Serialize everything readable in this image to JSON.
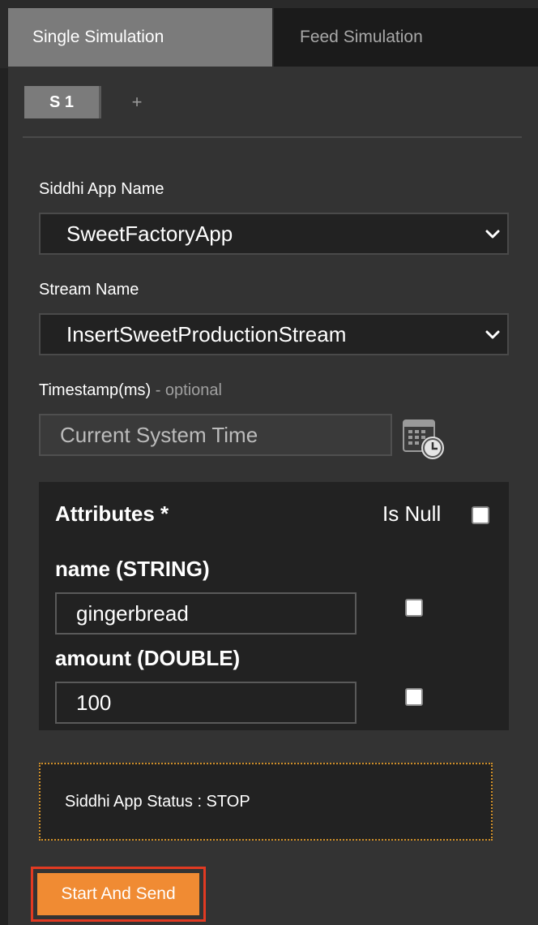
{
  "tabs": [
    {
      "label": "Single Simulation",
      "active": true
    },
    {
      "label": "Feed Simulation",
      "active": false
    }
  ],
  "simulation_tabs": {
    "current": "S 1",
    "add_label": "+"
  },
  "form": {
    "app_name_label": "Siddhi App Name",
    "app_name_value": "SweetFactoryApp",
    "stream_name_label": "Stream Name",
    "stream_name_value": "InsertSweetProductionStream",
    "timestamp_label": "Timestamp(ms)",
    "timestamp_optional": " - optional",
    "timestamp_placeholder": "Current System Time"
  },
  "attributes": {
    "title": "Attributes *",
    "is_null_label": "Is Null",
    "items": [
      {
        "label": "name (STRING)",
        "value": "gingerbread",
        "is_null": false
      },
      {
        "label": "amount (DOUBLE)",
        "value": "100",
        "is_null": false
      }
    ]
  },
  "status": {
    "text": "Siddhi App Status : STOP"
  },
  "actions": {
    "start_label": "Start And Send"
  },
  "colors": {
    "accent": "#f08b33",
    "highlight_outline": "#e23a22",
    "status_border": "#d0902a"
  }
}
